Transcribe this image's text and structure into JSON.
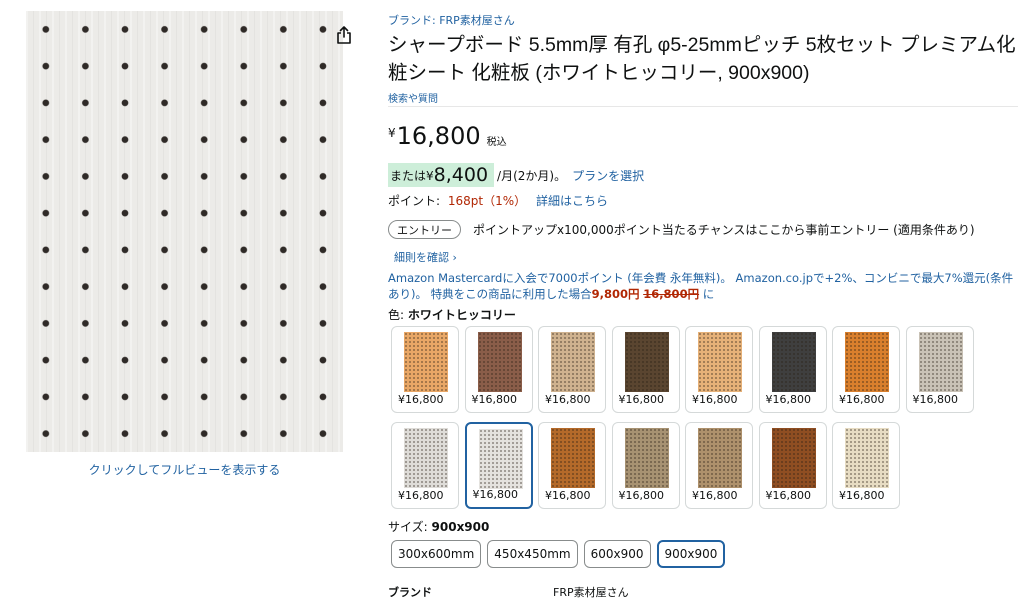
{
  "image": {
    "fullview_link": "クリックしてフルビューを表示する",
    "share_icon": "share-icon"
  },
  "product": {
    "brand_link": "ブランド: FRP素材屋さん",
    "title": "シャープボード 5.5mm厚 有孔 φ5-25mmピッチ 5枚セット プレミアム化粧シート 化粧板 (ホワイトヒッコリー, 900x900)",
    "qa_link": "検索や質問"
  },
  "price": {
    "currency": "¥",
    "amount": "16,800",
    "tax_label": "税込"
  },
  "installment": {
    "prefix": "または¥",
    "amount": "8,400",
    "per_month": "/月(2か月)。",
    "plan_link": "プランを選択"
  },
  "points": {
    "label": "ポイント:",
    "value": "168pt（1%）",
    "details_link": "詳細はこちら"
  },
  "entry": {
    "button_label": "エントリー",
    "text": "ポイントアップx100,000ポイント当たるチャンスはここから事前エントリー (適用条件あり)",
    "confirm_link": "細則を確認 ›"
  },
  "mastercard": {
    "text_before": "Amazon Mastercardに入会で7000ポイント (年会費 永年無料)。 Amazon.co.jpで+2%、コンビニで最大7%還元(条件あり)。 特典をこの商品に利用した場合",
    "discounted": "9,800円",
    "original": "16,800円",
    "text_after": " に"
  },
  "color": {
    "label": "色:",
    "selected": "ホワイトヒッコリー",
    "swatches": [
      {
        "price": "¥16,800",
        "tone": "#e9a766"
      },
      {
        "price": "¥16,800",
        "tone": "#8a5d49"
      },
      {
        "price": "¥16,800",
        "tone": "#cfb28f"
      },
      {
        "price": "¥16,800",
        "tone": "#5a4530"
      },
      {
        "price": "¥16,800",
        "tone": "#e6b178"
      },
      {
        "price": "¥16,800",
        "tone": "#3f3f3f"
      },
      {
        "price": "¥16,800",
        "tone": "#d97f2d"
      },
      {
        "price": "¥16,800",
        "tone": "#c9c2b6"
      },
      {
        "price": "¥16,800",
        "tone": "#dedcd8"
      },
      {
        "price": "¥16,800",
        "tone": "#e4e2de",
        "selected": true
      },
      {
        "price": "¥16,800",
        "tone": "#b46a2a"
      },
      {
        "price": "¥16,800",
        "tone": "#a79272"
      },
      {
        "price": "¥16,800",
        "tone": "#ae916c"
      },
      {
        "price": "¥16,800",
        "tone": "#8f4e22"
      },
      {
        "price": "¥16,800",
        "tone": "#e7dcc3"
      }
    ]
  },
  "size": {
    "label": "サイズ:",
    "selected": "900x900",
    "options": [
      {
        "label": "300x600mm"
      },
      {
        "label": "450x450mm"
      },
      {
        "label": "600x900"
      },
      {
        "label": "900x900",
        "selected": true
      }
    ]
  },
  "specs": {
    "brand_key": "ブランド",
    "brand_value": "FRP素材屋さん"
  },
  "colors": {
    "link": "#2162a1",
    "price_red": "#b12704",
    "installment_bg": "#cdeed9",
    "selected_border": "#2162a1"
  }
}
